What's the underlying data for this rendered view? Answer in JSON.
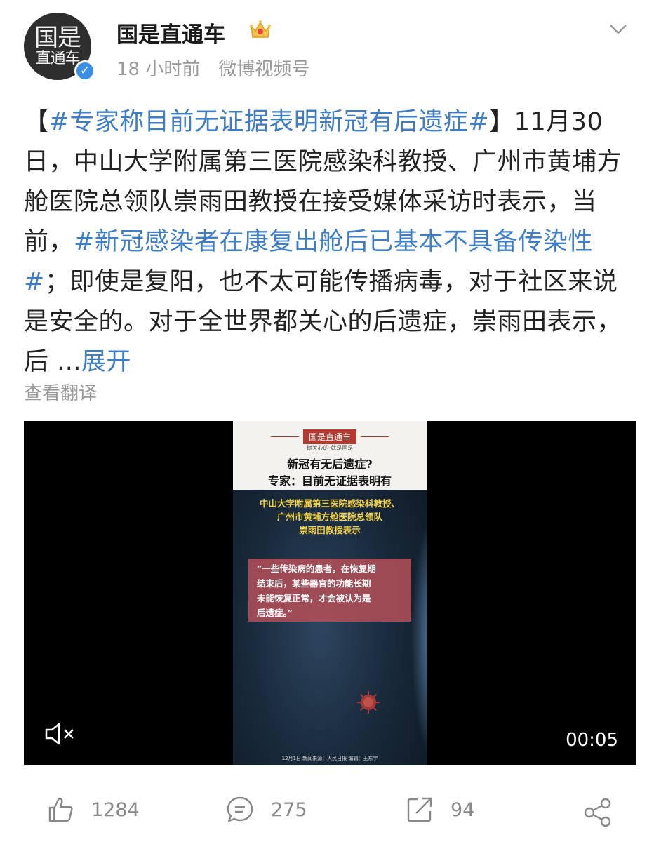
{
  "header": {
    "avatar_line1": "国是",
    "avatar_line2": "直通车",
    "username": "国是直通车",
    "time": "18 小时前",
    "source": "微博视频号"
  },
  "post": {
    "bracket_open": "【",
    "tag1": "#专家称目前无证据表明新冠有后遗症#",
    "bracket_close": "】",
    "text1": "11月30日，中山大学附属第三医院感染科教授、广州市黄埔方舱医院总领队崇雨田教授在接受媒体采访时表示，当前，",
    "tag2": "#新冠感染者在康复出舱后已基本不具备传染性#",
    "text2": "；即使是复阳，也不太可能传播病毒，对于社区来说是安全的。对于全世界都关心的后遗症，崇雨田表示，后 ...",
    "more": "展开",
    "translate": "查看翻译"
  },
  "video": {
    "frame_title": "国是直通车",
    "frame_slogan": "你关心的·就是国是",
    "question_line1": "新冠有无后遗症?",
    "question_line2": "专家：目前无证据表明有",
    "speaker_line1": "中山大学附属第三医院感染科教授、",
    "speaker_line2": "广州市黄埔方舱医院总领队",
    "speaker_line3": "崇雨田教授表示",
    "quote_line1": "“一些传染病的患者，在恢复期",
    "quote_line2": "结束后，某些器官的功能长期",
    "quote_line3": "未能恢复正常，才会被认为是",
    "quote_line4": "后遗症。”",
    "credit": "12月1日  新闻来源：人民日报  编辑：王东宇",
    "duration": "00:05"
  },
  "actions": {
    "likes": "1284",
    "comments": "275",
    "reposts": "94"
  },
  "colors": {
    "link": "#3e7dc8",
    "muted": "#9a9a9a",
    "verified": "#3b8ee8"
  },
  "icons": [
    "crown-icon",
    "verified-icon",
    "chevron-down-icon",
    "mute-icon",
    "like-icon",
    "comment-icon",
    "repost-icon",
    "share-icon"
  ]
}
